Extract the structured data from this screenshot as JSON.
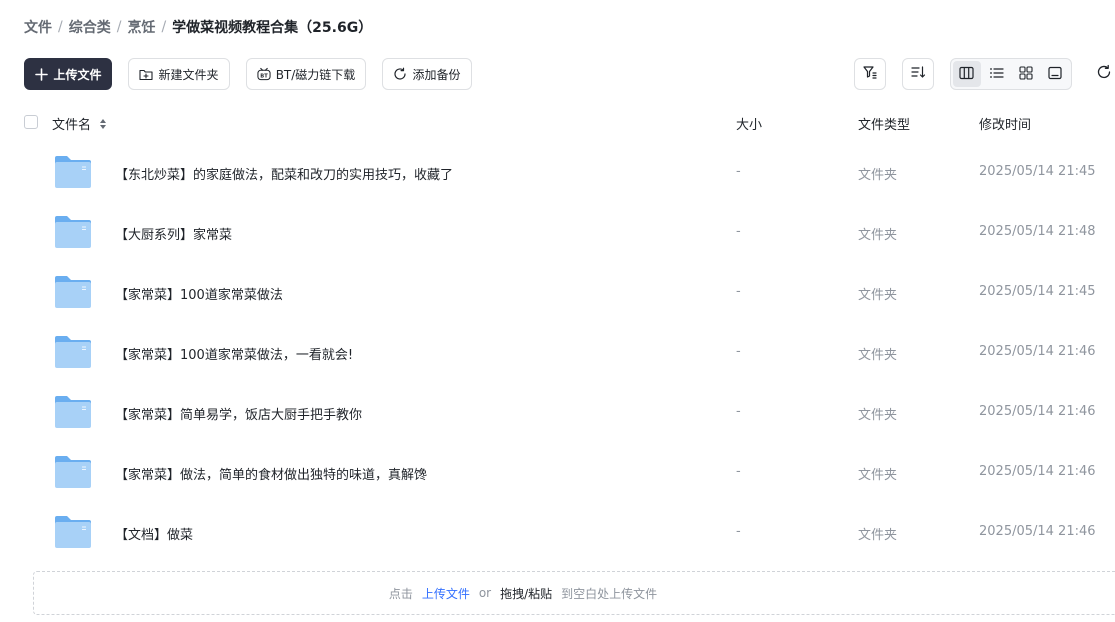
{
  "breadcrumb": {
    "items": [
      "文件",
      "综合类",
      "烹饪"
    ],
    "separator": "/",
    "current": "学做菜视频教程合集（25.6G）"
  },
  "toolbar": {
    "upload_label": "上传文件",
    "new_folder_label": "新建文件夹",
    "bt_label": "BT/磁力链下载",
    "backup_label": "添加备份"
  },
  "icons": {
    "upload": "plus-icon",
    "new_folder": "folder-add-icon",
    "bt": "magnet-icon",
    "backup": "sync-icon",
    "filter": "filter-icon",
    "sort": "sort-icon",
    "view_columns": "columns-view-icon",
    "view_list": "list-view-icon",
    "view_grid": "grid-view-icon",
    "view_preview": "preview-view-icon",
    "refresh": "refresh-icon",
    "folder": "folder-icon"
  },
  "table": {
    "headers": {
      "name": "文件名",
      "size": "大小",
      "type": "文件类型",
      "modified": "修改时间"
    },
    "rows": [
      {
        "name": "【东北炒菜】的家庭做法，配菜和改刀的实用技巧，收藏了",
        "size": "-",
        "type": "文件夹",
        "modified": "2025/05/14 21:45"
      },
      {
        "name": "【大厨系列】家常菜",
        "size": "-",
        "type": "文件夹",
        "modified": "2025/05/14 21:48"
      },
      {
        "name": "【家常菜】100道家常菜做法",
        "size": "-",
        "type": "文件夹",
        "modified": "2025/05/14 21:45"
      },
      {
        "name": "【家常菜】100道家常菜做法，一看就会!",
        "size": "-",
        "type": "文件夹",
        "modified": "2025/05/14 21:46"
      },
      {
        "name": "【家常菜】简单易学，饭店大厨手把手教你",
        "size": "-",
        "type": "文件夹",
        "modified": "2025/05/14 21:46"
      },
      {
        "name": "【家常菜】做法，简单的食材做出独特的味道，真解馋",
        "size": "-",
        "type": "文件夹",
        "modified": "2025/05/14 21:46"
      },
      {
        "name": "【文档】做菜",
        "size": "-",
        "type": "文件夹",
        "modified": "2025/05/14 21:46"
      }
    ]
  },
  "dropzone": {
    "prefix": "点击",
    "link": "上传文件",
    "or": "or",
    "action": "拖拽/粘贴",
    "suffix": "到空白处上传文件"
  },
  "colors": {
    "primary_button": "#2d3142",
    "folder_light": "#a8d1f7",
    "folder_dark": "#6aaef0",
    "link": "#3370ff"
  }
}
